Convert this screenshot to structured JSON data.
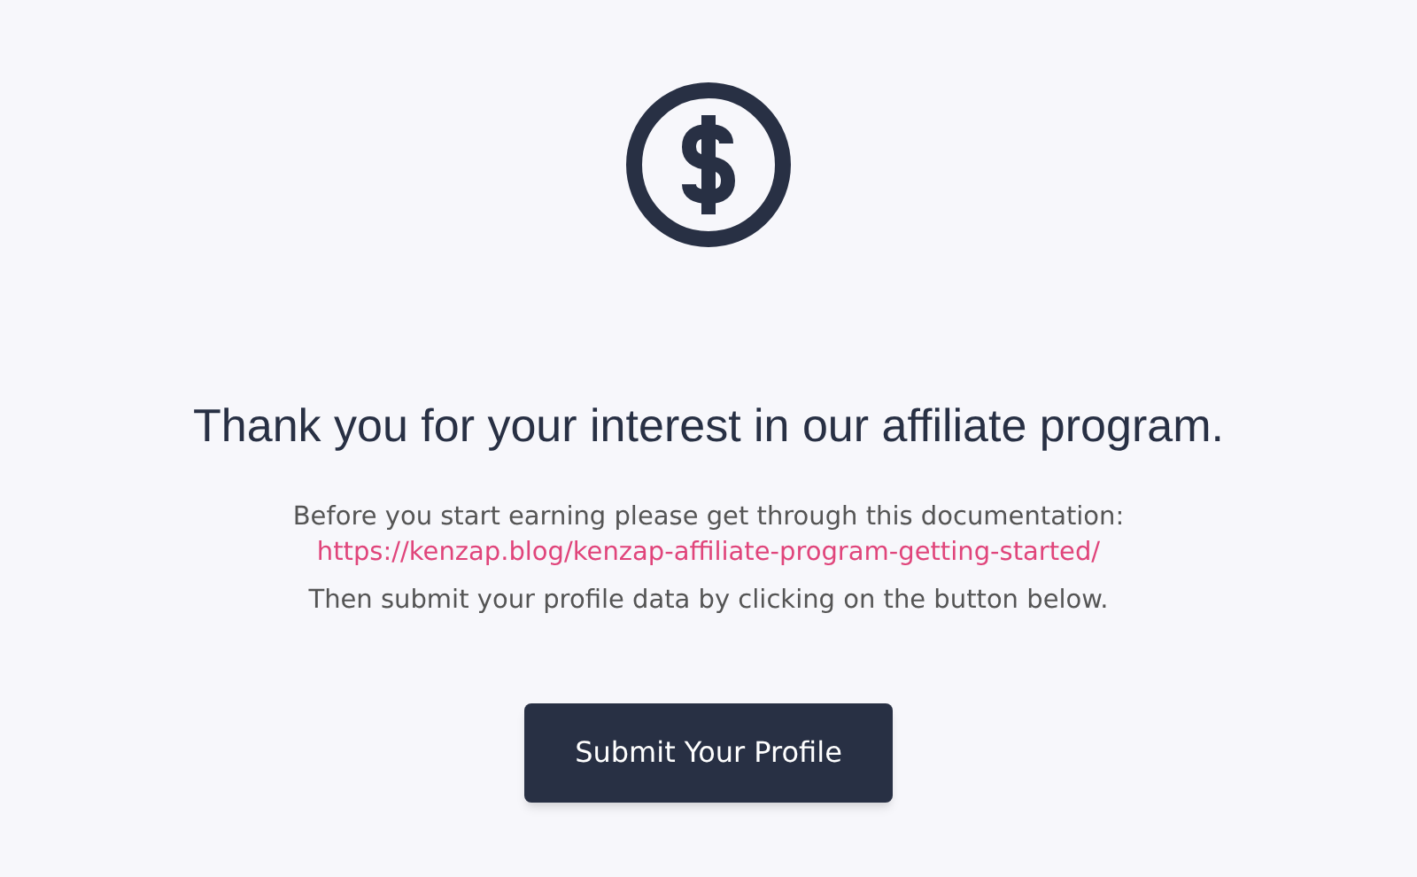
{
  "heading": "Thank you for your interest in our affiliate program.",
  "intro": {
    "text": "Before you start earning please get through this documentation:",
    "link": "https://kenzap.blog/kenzap-affiliate-program-getting-started/"
  },
  "instruction": "Then submit your profile data by clicking on the button below.",
  "button": {
    "label": "Submit Your Profile"
  }
}
